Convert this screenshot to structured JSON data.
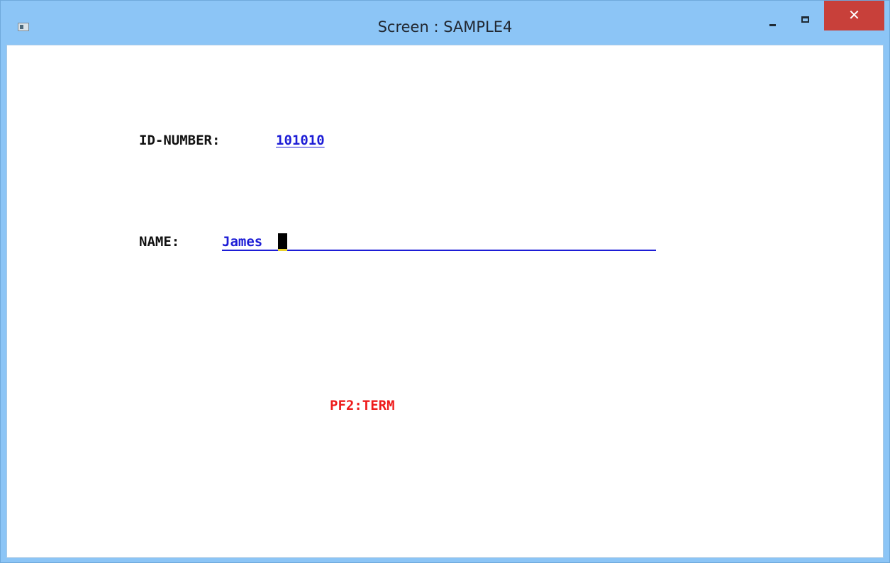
{
  "window": {
    "title": "Screen : SAMPLE4",
    "close_symbol": "✕",
    "icons": [
      "app-icon",
      "minimize-icon",
      "maximize-icon",
      "close-icon"
    ]
  },
  "screen": {
    "id_label": "ID-NUMBER:",
    "id_value": "101010",
    "name_label": "NAME:",
    "name_value": "James",
    "pf_key": "PF2:TERM"
  },
  "colors": {
    "titlebar": "#8cc5f6",
    "close_button": "#c8403a",
    "field_text": "#1d1dd6",
    "label_text": "#111111",
    "pf_key_text": "#ee1b1b",
    "cursor": "#000000"
  }
}
